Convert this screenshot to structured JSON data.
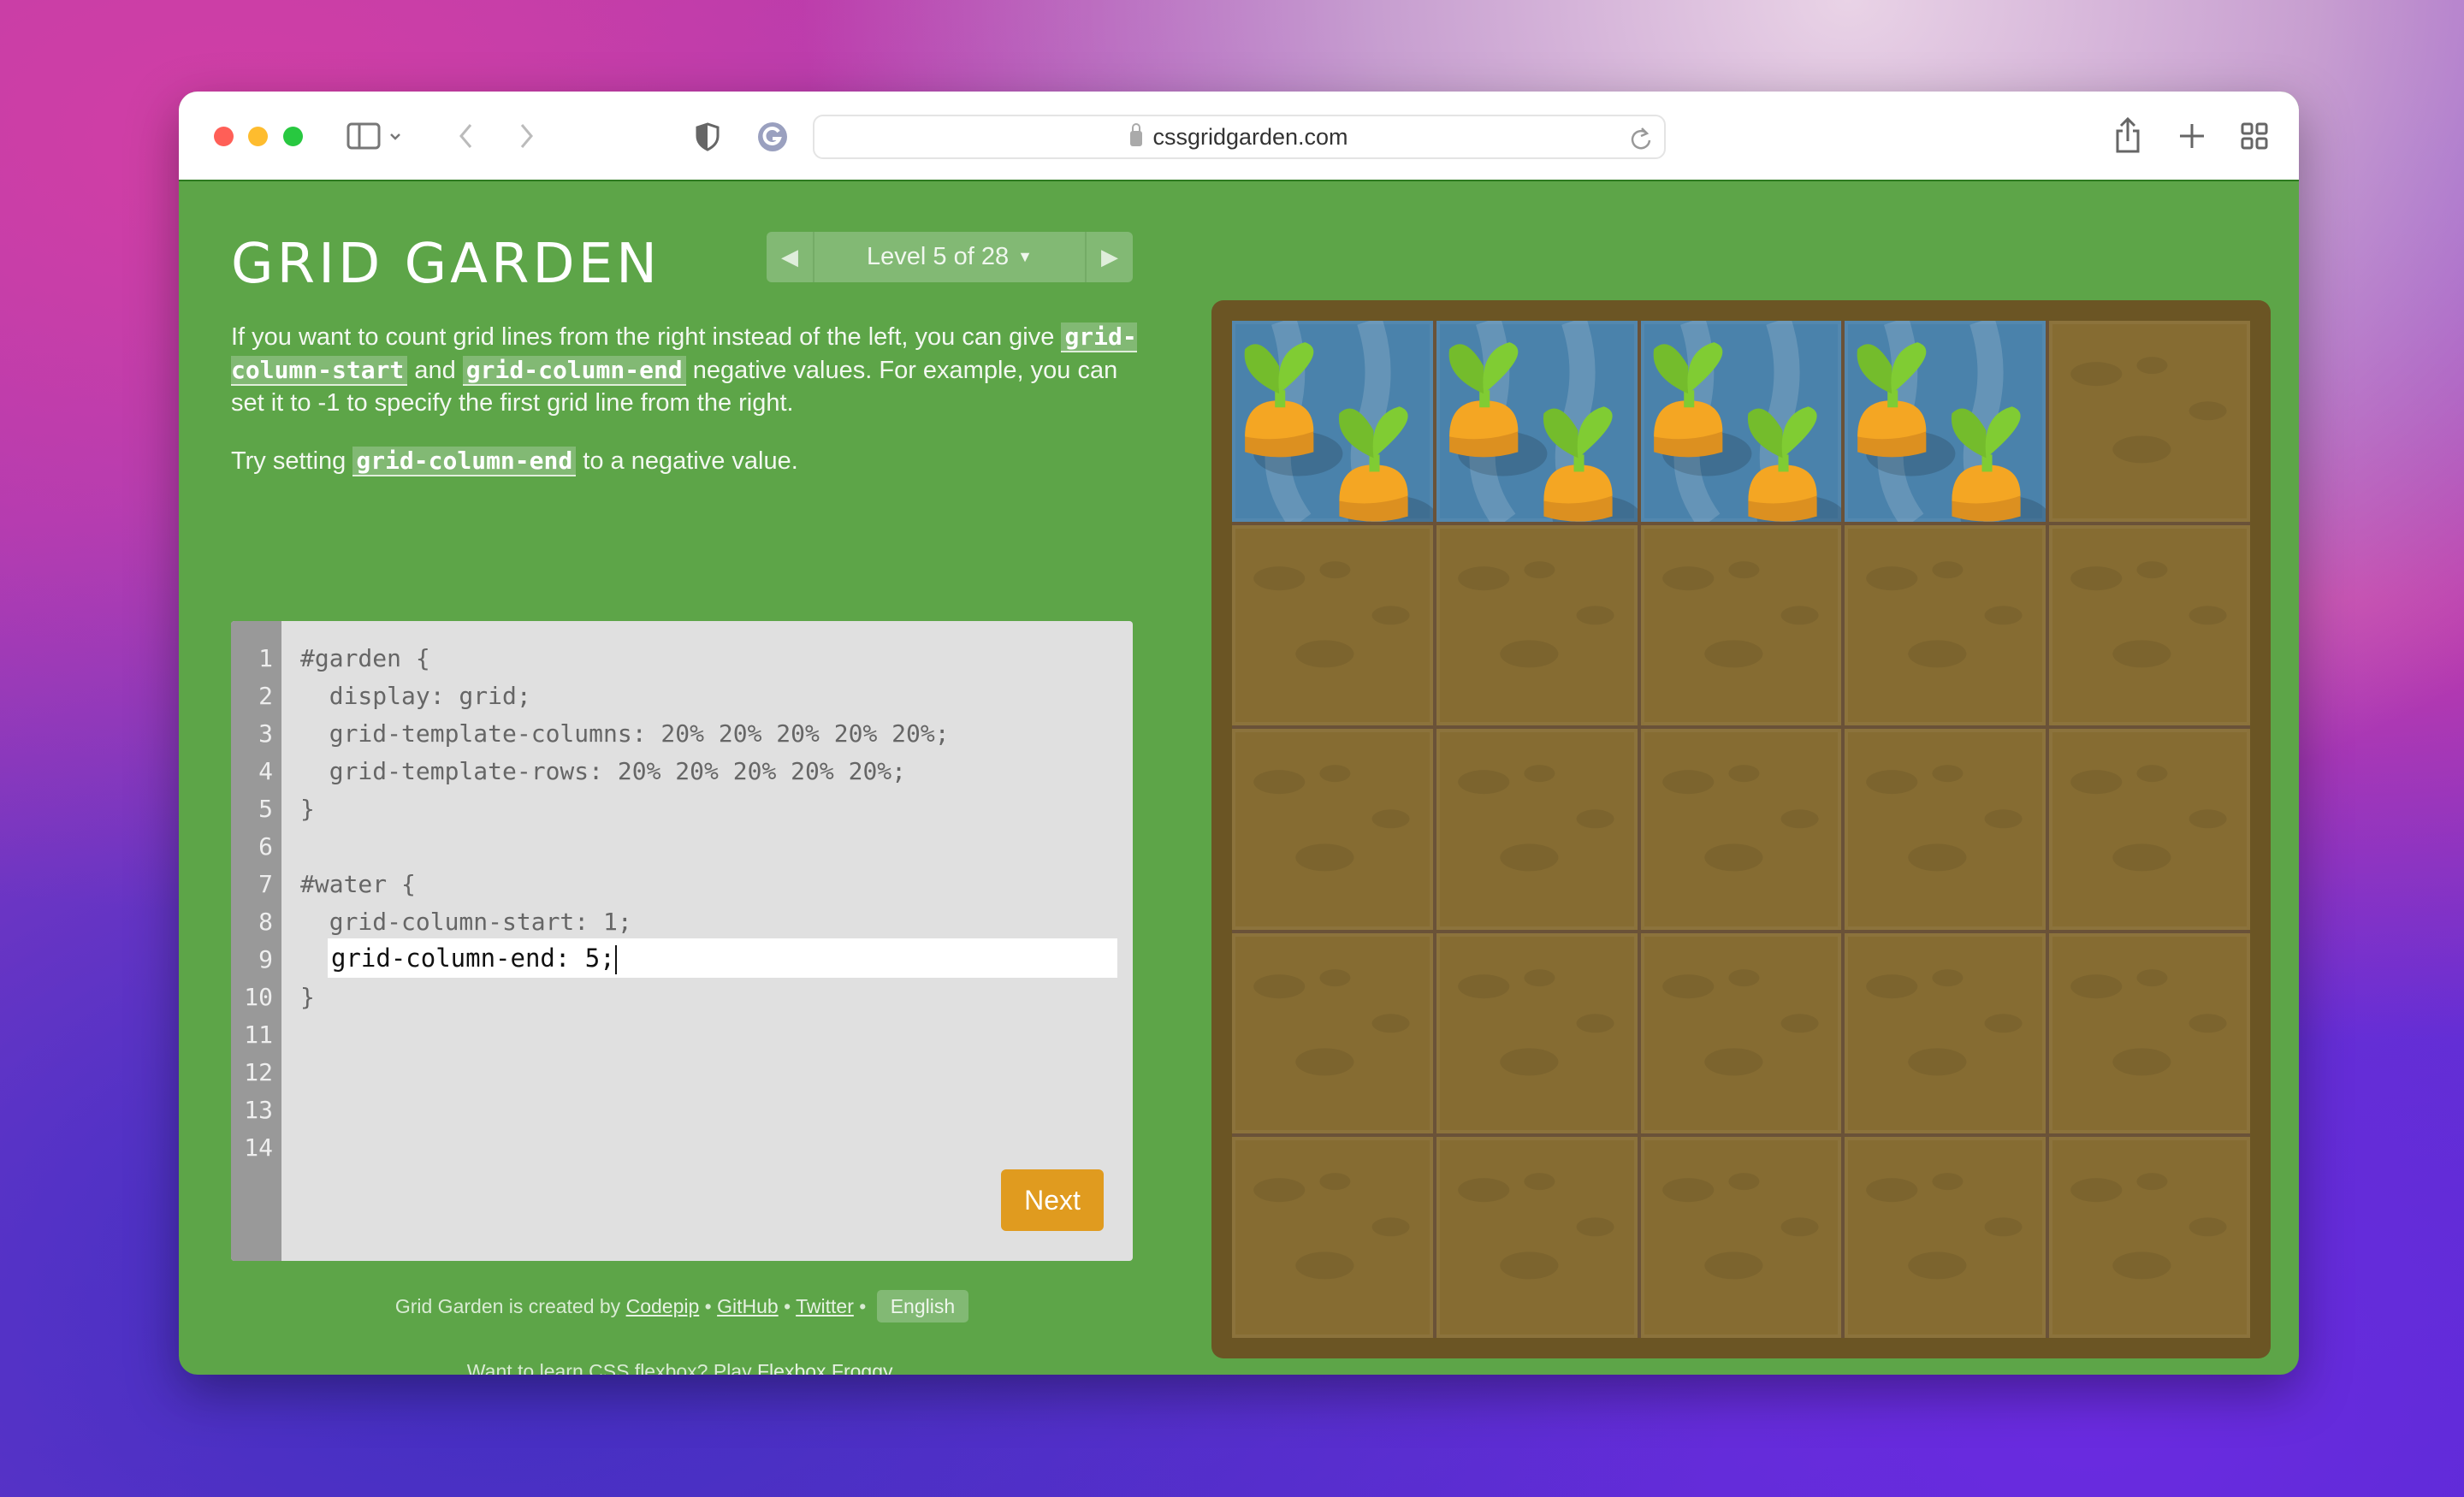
{
  "browser": {
    "url": "cssgridgarden.com",
    "traffic_colors": [
      "#ff5f57",
      "#febc2e",
      "#28c840"
    ]
  },
  "page": {
    "title": "GRID GARDEN",
    "level": {
      "label": "Level 5 of 28",
      "current": 5,
      "total": 28
    },
    "instructions": {
      "p1_a": "If you want to count grid lines from the right instead of the left, you can give ",
      "p1_code1": "grid-column-start",
      "p1_b": " and ",
      "p1_code2": "grid-column-end",
      "p1_c": " negative values. For example, you can set it to -1 to specify the first grid line from the right.",
      "p2_a": "Try setting ",
      "p2_code": "grid-column-end",
      "p2_b": " to a negative value."
    },
    "editor": {
      "lines": [
        "#garden {",
        "  display: grid;",
        "  grid-template-columns: 20% 20% 20% 20% 20%;",
        "  grid-template-rows: 20% 20% 20% 20% 20%;",
        "}",
        "",
        "#water {",
        "  grid-column-start: 1;",
        "",
        "}",
        "",
        "",
        "",
        ""
      ],
      "input_value": "grid-column-end: 5;",
      "input_line": 9,
      "next_label": "Next"
    },
    "footer": {
      "created_by": "Grid Garden is created by ",
      "codepip": "Codepip",
      "sep": " • ",
      "github": "GitHub",
      "twitter": "Twitter",
      "language": "English",
      "flexbox_prompt": "Want to learn CSS flexbox? Play ",
      "flexbox_link": "Flexbox Froggy",
      "period": "."
    },
    "garden": {
      "rows": 5,
      "columns": 5,
      "water": {
        "row": 1,
        "column_start": 1,
        "column_end": 5
      },
      "colors": {
        "soil": "#866c32",
        "water": "#4a82ab",
        "border": "#6b5524",
        "carrot": "#f4a623",
        "leaf": "#80cc33"
      }
    }
  }
}
